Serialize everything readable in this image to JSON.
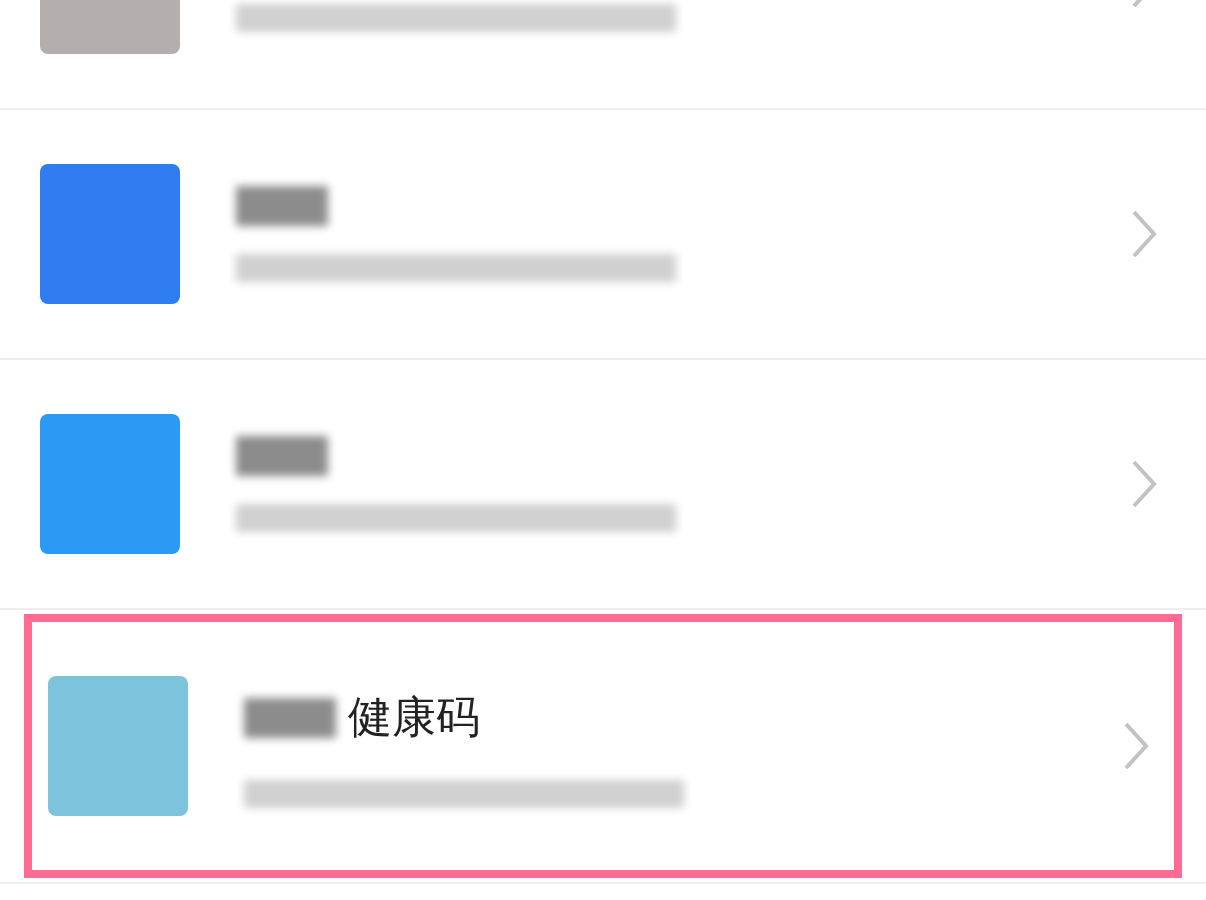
{
  "rows": [
    {
      "color": "#b5aeae",
      "highlighted": false
    },
    {
      "color": "#2f7cf0",
      "highlighted": false
    },
    {
      "color": "#2a9af5",
      "highlighted": false
    },
    {
      "color": "#7ec3dc",
      "title": "健康码",
      "highlighted": true
    }
  ]
}
